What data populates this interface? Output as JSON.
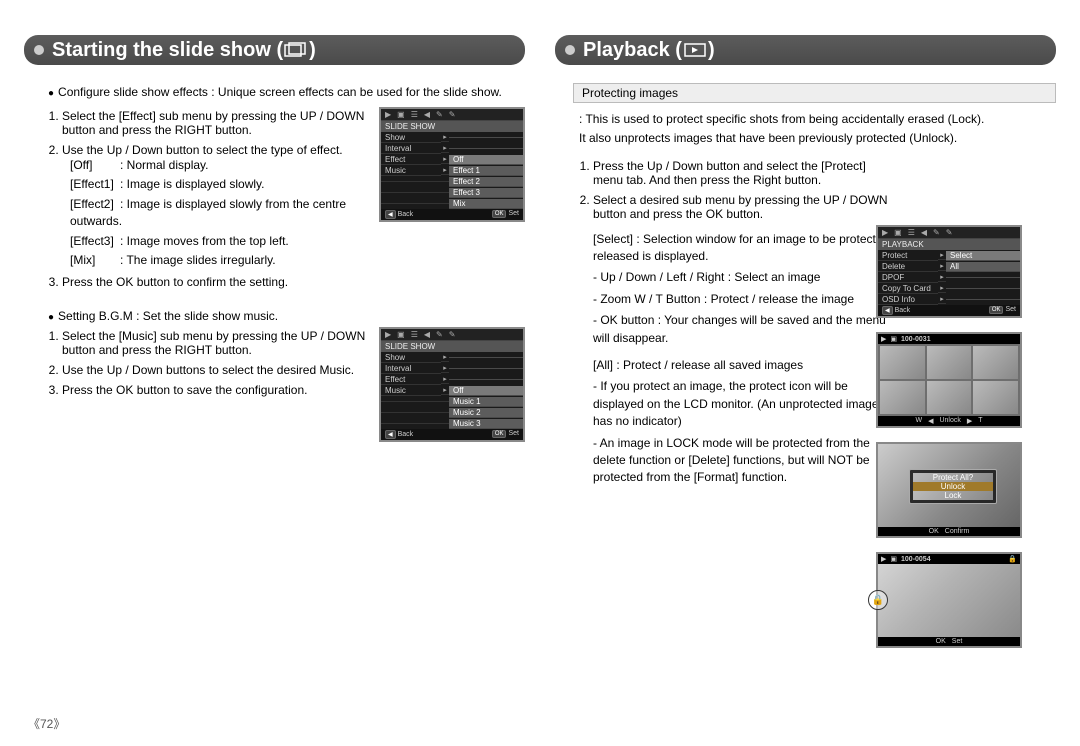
{
  "page_number": "《72》",
  "left": {
    "title_prefix": "Starting the slide show ( ",
    "title_suffix": " )",
    "intro": "Configure slide show effects : Unique screen effects can be used for the slide show.",
    "steps1": [
      "Select the [Effect] sub menu by pressing the UP / DOWN button and press the RIGHT button.",
      "Use the Up / Down button to select the type of effect."
    ],
    "effects": [
      {
        "k": "[Off]",
        "v": ": Normal display."
      },
      {
        "k": "[Effect1]",
        "v": ": Image is displayed slowly."
      },
      {
        "k": "[Effect2]",
        "v": ": Image is displayed slowly from the centre outwards."
      },
      {
        "k": "[Effect3]",
        "v": ": Image moves from the top left."
      },
      {
        "k": "[Mix]",
        "v": ": The image slides irregularly."
      }
    ],
    "step1_3": "Press the OK button to confirm the setting.",
    "section2": "Setting B.G.M : Set the slide show music.",
    "steps2": [
      "Select the [Music] sub menu by pressing the UP / DOWN button and press the RIGHT button.",
      "Use the Up / Down buttons to select the desired Music.",
      "Press the OK button to save the configuration."
    ],
    "lcd1": {
      "title": "SLIDE SHOW",
      "rowsL": [
        "Show",
        "Interval",
        "Effect",
        "Music"
      ],
      "rowsR": [
        "Off",
        "Effect 1",
        "Effect 2",
        "Effect 3",
        "Mix"
      ],
      "foot_back": "Back",
      "foot_ok": "Set"
    },
    "lcd2": {
      "title": "SLIDE SHOW",
      "rowsL": [
        "Show",
        "Interval",
        "Effect",
        "Music"
      ],
      "rowsR": [
        "Off",
        "Music 1",
        "Music 2",
        "Music 3"
      ],
      "foot_back": "Back",
      "foot_ok": "Set"
    }
  },
  "right": {
    "title_prefix": "Playback ( ",
    "title_suffix": " )",
    "chip": "Protecting images",
    "desc1": ": This is used to protect specific shots from being accidentally erased (Lock).",
    "desc2": "It also unprotects images that have been previously protected (Unlock).",
    "steps": [
      "Press the Up / Down button and select the [Protect] menu tab. And then press the Right button.",
      "Select a desired sub menu by pressing the UP / DOWN button and press the OK button."
    ],
    "select_title": "[Select] : Selection window for an image to be protected / released is displayed.",
    "select_lines": [
      "- Up / Down / Left / Right : Select an image",
      "- Zoom W / T Button : Protect / release the image",
      "- OK button : Your changes will be saved and the menu will disappear."
    ],
    "all_title": "[All] : Protect / release all saved images",
    "all_lines": [
      "- If you protect an image, the protect icon will be displayed on the LCD monitor. (An unprotected image has no indicator)",
      "- An image in LOCK mode will be protected from the delete function or [Delete] functions, but will NOT be protected from the [Format] function."
    ],
    "lcd_menu": {
      "title": "PLAYBACK",
      "rowsL": [
        "Protect",
        "Delete",
        "DPOF",
        "Copy To Card",
        "OSD Info"
      ],
      "rowsR": [
        "Select",
        "All"
      ],
      "foot_back": "Back",
      "foot_ok": "Set"
    },
    "lcd_select": {
      "file": "100-0031",
      "foot": [
        "W",
        "Unlock",
        "T"
      ]
    },
    "lcd_all": {
      "dlg_title": "Protect All?",
      "opt1": "Unlock",
      "opt2": "Lock",
      "foot_ok": "Confirm"
    },
    "lcd_locked": {
      "file": "100-0054",
      "foot_ok": "Set"
    }
  }
}
